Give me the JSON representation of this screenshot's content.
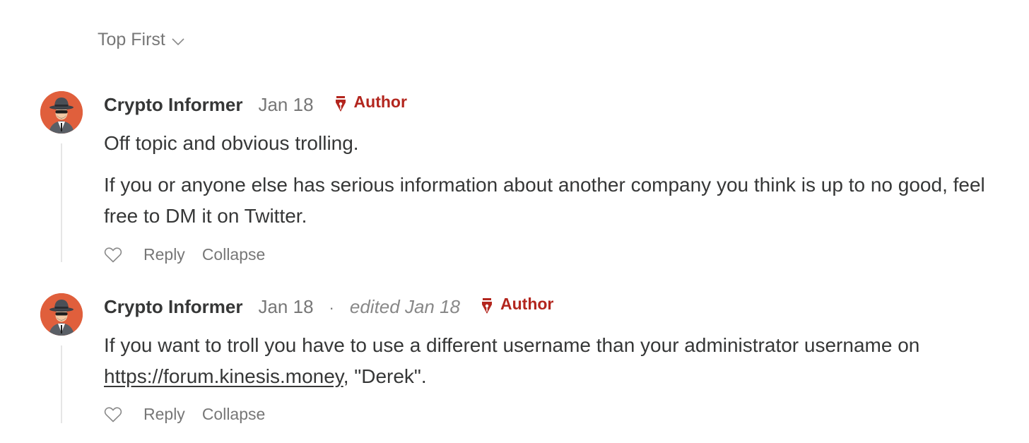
{
  "sort": {
    "label": "Top First"
  },
  "comments": [
    {
      "name": "Crypto Informer",
      "date": "Jan 18",
      "edited": "",
      "badge": "Author",
      "paragraphs": [
        "Off topic and obvious trolling.",
        "If you or anyone else has serious information about another company you think is up to no good, feel free to DM it on Twitter."
      ],
      "actions": {
        "reply": "Reply",
        "collapse": "Collapse"
      }
    },
    {
      "name": "Crypto Informer",
      "date": "Jan 18",
      "separator": "·",
      "edited": "edited Jan 18",
      "badge": "Author",
      "text_before_link": "If you want to troll you have to use a different username than your administrator username on ",
      "link": "https://forum.kinesis.money",
      "text_after_link": ", \"Derek\".",
      "actions": {
        "reply": "Reply",
        "collapse": "Collapse"
      }
    }
  ],
  "colors": {
    "avatar_bg": "#e05f3c",
    "author_badge": "#b3261e",
    "text": "#363737",
    "muted": "#777777"
  },
  "icons": {
    "sort": "chevron-down-icon",
    "badge": "pen-nib-icon",
    "like": "heart-icon"
  }
}
